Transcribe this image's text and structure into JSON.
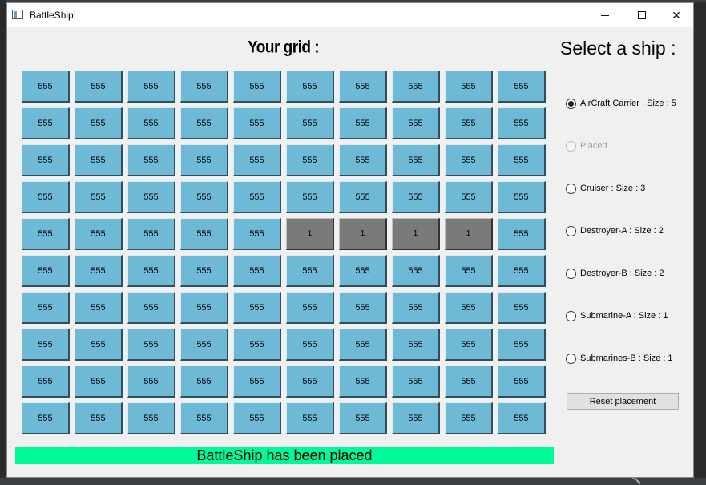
{
  "window": {
    "title": "BattleShip!"
  },
  "grid": {
    "title": "Your grid :",
    "cells": [
      [
        "555",
        "555",
        "555",
        "555",
        "555",
        "555",
        "555",
        "555",
        "555",
        "555"
      ],
      [
        "555",
        "555",
        "555",
        "555",
        "555",
        "555",
        "555",
        "555",
        "555",
        "555"
      ],
      [
        "555",
        "555",
        "555",
        "555",
        "555",
        "555",
        "555",
        "555",
        "555",
        "555"
      ],
      [
        "555",
        "555",
        "555",
        "555",
        "555",
        "555",
        "555",
        "555",
        "555",
        "555"
      ],
      [
        "555",
        "555",
        "555",
        "555",
        "555",
        "1",
        "1",
        "1",
        "1",
        "555"
      ],
      [
        "555",
        "555",
        "555",
        "555",
        "555",
        "555",
        "555",
        "555",
        "555",
        "555"
      ],
      [
        "555",
        "555",
        "555",
        "555",
        "555",
        "555",
        "555",
        "555",
        "555",
        "555"
      ],
      [
        "555",
        "555",
        "555",
        "555",
        "555",
        "555",
        "555",
        "555",
        "555",
        "555"
      ],
      [
        "555",
        "555",
        "555",
        "555",
        "555",
        "555",
        "555",
        "555",
        "555",
        "555"
      ],
      [
        "555",
        "555",
        "555",
        "555",
        "555",
        "555",
        "555",
        "555",
        "555",
        "555"
      ]
    ],
    "empty_color": "#6db9d6",
    "placed_color": "#7a7a7a"
  },
  "ships": {
    "title": "Select a ship :",
    "items": [
      {
        "label": "AirCraft Carrier : Size : 5",
        "checked": true,
        "disabled": false
      },
      {
        "label": "Placed",
        "checked": false,
        "disabled": true
      },
      {
        "label": "Cruiser : Size : 3",
        "checked": false,
        "disabled": false
      },
      {
        "label": "Destroyer-A : Size : 2",
        "checked": false,
        "disabled": false
      },
      {
        "label": "Destroyer-B : Size : 2",
        "checked": false,
        "disabled": false
      },
      {
        "label": "Submarine-A : Size : 1",
        "checked": false,
        "disabled": false
      },
      {
        "label": "Submarines-B : Size : 1",
        "checked": false,
        "disabled": false
      }
    ],
    "reset_label": "Reset placement"
  },
  "status": {
    "text": "BattleShip has been placed",
    "color": "#00fa9a"
  }
}
